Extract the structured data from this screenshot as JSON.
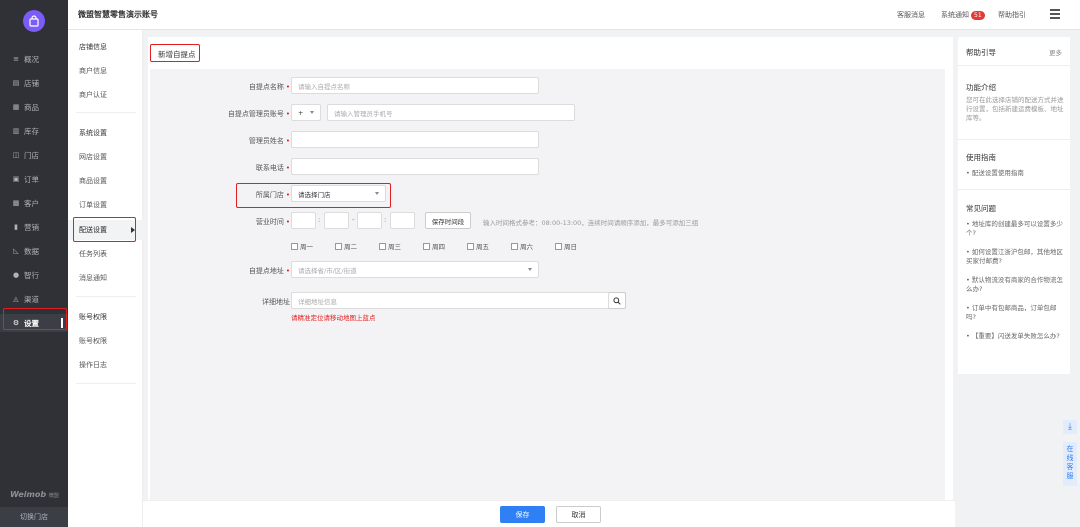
{
  "app": {
    "account_title": "微盟智慧零售演示账号",
    "brand_name": "Weimob",
    "brand_sub": "微盟",
    "switch_store": "切换门店"
  },
  "nav": {
    "items": [
      {
        "label": "概况",
        "icon": "overview-icon"
      },
      {
        "label": "店铺",
        "icon": "shop-icon"
      },
      {
        "label": "商品",
        "icon": "goods-icon"
      },
      {
        "label": "库存",
        "icon": "stock-icon"
      },
      {
        "label": "门店",
        "icon": "store-icon"
      },
      {
        "label": "订单",
        "icon": "order-icon"
      },
      {
        "label": "客户",
        "icon": "customer-icon"
      },
      {
        "label": "营销",
        "icon": "marketing-icon"
      },
      {
        "label": "数据",
        "icon": "data-icon"
      },
      {
        "label": "智行",
        "icon": "smart-icon"
      },
      {
        "label": "渠道",
        "icon": "channel-icon"
      },
      {
        "label": "设置",
        "icon": "settings-icon"
      }
    ],
    "active_index": 11
  },
  "topbar": {
    "links": [
      "客服消息",
      "系统通知",
      "帮助指引"
    ],
    "notify_count": "51"
  },
  "submenu": {
    "group1": [
      "店铺信息",
      "商户信息",
      "商户认证"
    ],
    "group2": [
      "系统设置",
      "网店设置",
      "商品设置",
      "订单设置",
      "配送设置",
      "任务列表",
      "消息通知"
    ],
    "group3": [
      "账号权限",
      "账号权限",
      "操作日志"
    ]
  },
  "form": {
    "page_title": "新增自提点",
    "name_label": "自提点名称",
    "name_placeholder": "请输入自提点名称",
    "admin_label": "自提点管理员账号",
    "admin_code": "+",
    "admin_placeholder": "请输入管理员手机号",
    "manager_label": "管理员姓名",
    "phone_label": "联系电话",
    "store_label": "所属门店",
    "store_value": "请选择门店",
    "hours_label": "营业时间",
    "save_time_btn": "保存时间段",
    "hours_hint": "输入时间格式参考：08:00-13:00，连续时间请顺序添加，最多可添加三组",
    "weekdays": [
      "周一",
      "周二",
      "周三",
      "周四",
      "周五",
      "周六",
      "周日"
    ],
    "area_label": "自提点地址",
    "area_placeholder": "请选择省/市/区/街道",
    "address_label": "详细地址",
    "address_placeholder": "详细地址信息",
    "address_error": "请精准定位请移动地图上蓝点",
    "save_btn": "保存",
    "cancel_btn": "取消"
  },
  "help": {
    "title": "帮助引导",
    "more": "更多",
    "intro_title": "功能介绍",
    "intro_text": "您可在此选择店铺的配送方式并进行设置，包括新建运费模板、地址库等。",
    "guide_title": "使用指南",
    "guide_items": [
      "配送设置使用指南"
    ],
    "faq_title": "常见问题",
    "faq_items": [
      "地址库的创建最多可以设置多少个?",
      "如何设置江浙沪包邮，其他地区买家付邮费?",
      "默认物流没有商家的合作物流怎么办?",
      "订单中有包邮商品，订单包邮吗?",
      "【重要】闪送发单失败怎么办?"
    ]
  },
  "float": {
    "chat_label": "在线客服"
  },
  "colors": {
    "nav_bg": "#2f3136",
    "primary": "#2f7ff5",
    "highlight_red": "#e02020",
    "logo": "#7b5cf6"
  }
}
